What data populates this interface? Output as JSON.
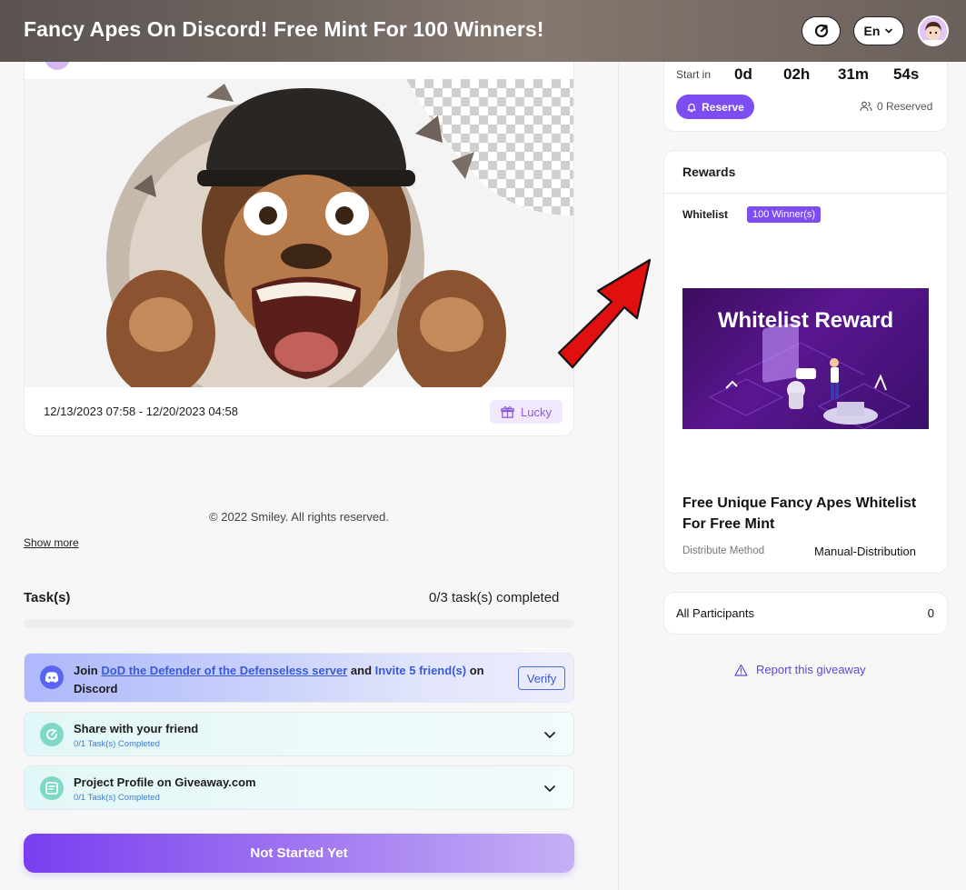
{
  "header": {
    "title": "Fancy Apes On Discord! Free Mint For 100 Winners!",
    "language": "En"
  },
  "main": {
    "date_range": "12/13/2023 07:58 - 12/20/2023 04:58",
    "type_badge": "Lucky",
    "copyright": "© 2022 Smiley. All rights reserved.",
    "show_more": "Show more"
  },
  "tasks": {
    "title": "Task(s)",
    "completed_text": "0/3 task(s) completed",
    "progress": 0,
    "discord": {
      "prefix": "Join",
      "server_link": "DoD the Defender of the Defenseless server",
      "middle": "and",
      "invite": "Invite 5 friend(s)",
      "on": "on",
      "platform": "Discord",
      "verify_label": "Verify"
    },
    "share": {
      "name": "Share with your friend",
      "status": "0/1 Task(s) Completed"
    },
    "profile": {
      "name": "Project Profile on Giveaway.com",
      "status": "0/1 Task(s) Completed"
    },
    "cta": "Not Started Yet"
  },
  "timer": {
    "start_label": "Start in",
    "days": "0d",
    "hours": "02h",
    "minutes": "31m",
    "seconds": "54s",
    "reserve_label": "Reserve",
    "reserved_text": "0 Reserved"
  },
  "rewards": {
    "title": "Rewards",
    "type": "Whitelist",
    "winners": "100 Winner(s)",
    "image_title": "Whitelist Reward",
    "name": "Free Unique Fancy Apes Whitelist For Free Mint",
    "dist_label": "Distribute Method",
    "dist_value": "Manual-Distribution"
  },
  "participants": {
    "label": "All Participants",
    "count": "0"
  },
  "report": "Report this giveaway",
  "colors": {
    "accent": "#7c4df1",
    "link": "#3a5ad9",
    "annotation_arrow": "#e01010"
  }
}
